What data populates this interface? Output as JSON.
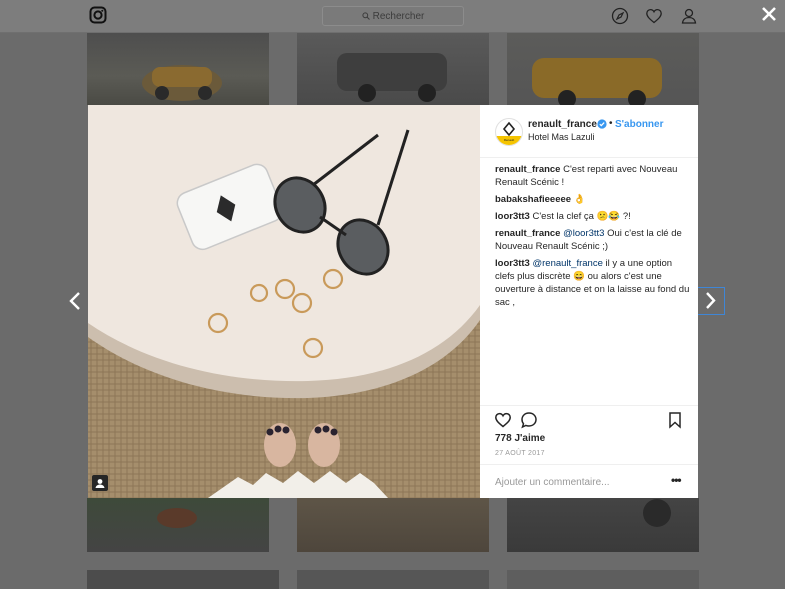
{
  "header": {
    "search_placeholder": "Rechercher",
    "icons": [
      "instagram-logo-icon",
      "compass-icon",
      "heart-icon",
      "profile-icon",
      "close-icon"
    ]
  },
  "post": {
    "username": "renault_france",
    "follow_label": "S'abonner",
    "separator": "•",
    "location": "Hotel Mas Lazuli",
    "avatar_text": "Renault",
    "comments": [
      {
        "user": "renault_france",
        "parts": [
          {
            "t": "C'est reparti avec Nouveau Renault Scénic !",
            "m": false
          }
        ]
      },
      {
        "user": "babakshafieeeee",
        "parts": [
          {
            "t": "👌",
            "m": false
          }
        ]
      },
      {
        "user": "loor3tt3",
        "parts": [
          {
            "t": "C'est la clef ça 😕😂 ?!",
            "m": false
          }
        ]
      },
      {
        "user": "renault_france",
        "parts": [
          {
            "t": "@loor3tt3",
            "m": true
          },
          {
            "t": " Oui c'est la clé de Nouveau Renault Scénic ;)",
            "m": false
          }
        ]
      },
      {
        "user": "loor3tt3",
        "parts": [
          {
            "t": "@renault_france",
            "m": true
          },
          {
            "t": " il y a une option clefs plus discrète 😄 ou alors c'est une ouverture à distance et on la laisse au fond du sac ,",
            "m": false
          }
        ]
      }
    ],
    "likes": "778 J'aime",
    "date": "27 AOÛT 2017",
    "comment_placeholder": "Ajouter un commentaire...",
    "more_label": "•••"
  },
  "colors": {
    "accent": "#3897f0",
    "verified": "#3897f0",
    "overlay": "#6b6b6b",
    "nav_focus": "#3f86d6"
  }
}
